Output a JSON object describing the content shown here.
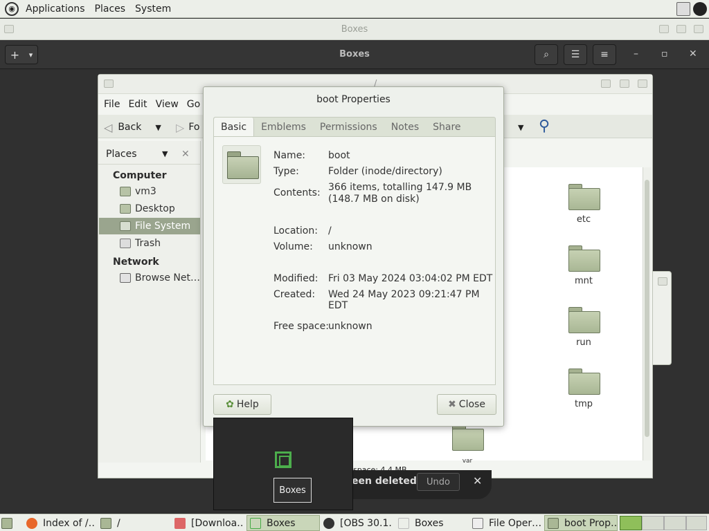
{
  "top_panel": {
    "menus": [
      "Applications",
      "Places",
      "System"
    ]
  },
  "boxes_window": {
    "title": "Boxes",
    "header_title": "Boxes",
    "add_button": "+",
    "add_dropdown": "▾",
    "search_icon": "⌕",
    "list_icon": "☰",
    "menu_icon": "≡",
    "minimize": "–",
    "maximize": "▫",
    "close": "✕"
  },
  "file_manager": {
    "title": "/",
    "menus": [
      "File",
      "Edit",
      "View",
      "Go"
    ],
    "toolbar": {
      "back_label": "Back",
      "forward_label": "Fo"
    },
    "sidebar": {
      "header": "Places",
      "sections": [
        {
          "title": "Computer",
          "items": [
            "vm3",
            "Desktop",
            "File System",
            "Trash"
          ]
        },
        {
          "title": "Network",
          "items": [
            "Browse Net…"
          ]
        }
      ],
      "active_item": "File System"
    },
    "folders": [
      "etc",
      "mnt",
      "run",
      "tmp"
    ],
    "partial_folder": "var",
    "status": "space: 4.4 MB"
  },
  "properties_dialog": {
    "title": "boot Properties",
    "tabs": [
      "Basic",
      "Emblems",
      "Permissions",
      "Notes",
      "Share"
    ],
    "active_tab": "Basic",
    "fields": [
      {
        "key": "Name:",
        "value": "boot"
      },
      {
        "key": "Type:",
        "value": "Folder (inode/directory)"
      },
      {
        "key": "Contents:",
        "value": "366 items, totalling 147.9 MB",
        "value2": "(148.7 MB on disk)"
      },
      {
        "key": "Location:",
        "value": "/"
      },
      {
        "key": "Volume:",
        "value": "unknown"
      },
      {
        "key": "Modified:",
        "value": "Fri 03 May 2024 03:04:02 PM EDT"
      },
      {
        "key": "Created:",
        "value": "Wed 24 May 2023 09:21:47 PM EDT"
      },
      {
        "key": "Free space:",
        "value": "unknown"
      }
    ],
    "help_button": "Help",
    "close_button": "Close"
  },
  "overlay": {
    "tooltip": "Boxes"
  },
  "snackbar": {
    "message": "een deleted",
    "undo": "Undo",
    "close": "✕"
  },
  "taskbar": {
    "items": [
      "Index of /…",
      "/",
      "[Downloa…",
      "Boxes",
      "[OBS 30.1.…",
      "Boxes",
      "File Oper…",
      "boot Prop…"
    ]
  },
  "colors": {
    "accent": "#9aa58e",
    "panel_bg": "#ecefe9",
    "dark_header": "#353535"
  }
}
